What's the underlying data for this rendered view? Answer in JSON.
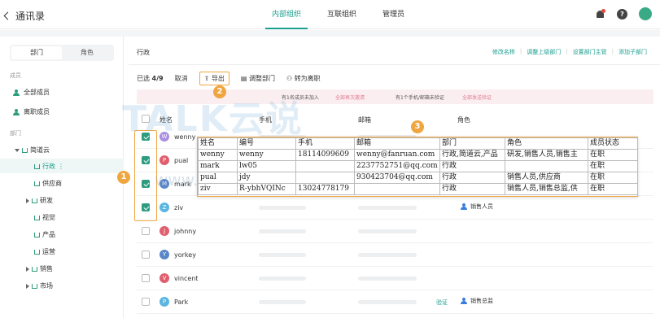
{
  "header": {
    "back_label": "通讯录",
    "tabs": [
      {
        "label": "内部组织",
        "active": true
      },
      {
        "label": "互联组织",
        "active": false
      },
      {
        "label": "管理员",
        "active": false
      }
    ]
  },
  "sidebar": {
    "segment": {
      "dept": "部门",
      "role": "角色"
    },
    "members_heading": "成员",
    "all_members": "全部成员",
    "left_members": "离职成员",
    "dept_heading": "部门",
    "tree": {
      "root": "简道云",
      "items": [
        "行政",
        "供应商",
        "研发",
        "视觉",
        "产品",
        "运营",
        "销售",
        "市场"
      ]
    }
  },
  "main": {
    "dept_title": "行政",
    "links": [
      "修改名称",
      "调整上级部门",
      "设置部门主管",
      "添加子部门"
    ],
    "toolbar": {
      "selected_prefix": "已选",
      "selected_count": "4/9",
      "cancel": "取消",
      "export": "导出",
      "adjust_dept": "调整部门",
      "to_leave": "转为离职"
    },
    "notice": {
      "text1": "有1名成员未加入",
      "link1": "全部再次邀请",
      "text2": "有1个手机/邮箱未验证",
      "link2": "全部发送验证"
    },
    "columns": {
      "name": "姓名",
      "phone": "手机",
      "email": "邮箱",
      "role": "角色"
    },
    "rows": [
      {
        "name": "wenny",
        "initial": "W",
        "color": "#a98de0",
        "checked": true,
        "role": ""
      },
      {
        "name": "pual",
        "initial": "P",
        "color": "#e05f6f",
        "checked": true,
        "role": ""
      },
      {
        "name": "mark",
        "initial": "M",
        "color": "#5a86c8",
        "checked": true,
        "role": ""
      },
      {
        "name": "ziv",
        "initial": "Z",
        "color": "#5bb5e0",
        "checked": true,
        "role": "销售人员"
      },
      {
        "name": "johnny",
        "initial": "J",
        "color": "#e05f6f",
        "checked": false,
        "role": ""
      },
      {
        "name": "yorkey",
        "initial": "Y",
        "color": "#5a86c8",
        "checked": false,
        "role": ""
      },
      {
        "name": "vincent",
        "initial": "V",
        "color": "#e05f6f",
        "checked": false,
        "role": ""
      },
      {
        "name": "Park",
        "initial": "P",
        "color": "#5bb5e0",
        "checked": false,
        "role": "销售总监",
        "verify": "验证"
      }
    ]
  },
  "badges": [
    "1",
    "2",
    "3"
  ],
  "popup": {
    "headers": [
      "姓名",
      "编号",
      "手机",
      "邮箱",
      "部门",
      "角色",
      "成员状态"
    ],
    "rows": [
      [
        "wenny",
        "wenny",
        "18114099609",
        "wenny@fanruan.com",
        "行政,简道云,产品",
        "研发,销售人员,销售主",
        "在职"
      ],
      [
        "mark",
        "lw05",
        "",
        "2237752751@qq.com",
        "行政",
        "",
        "在职"
      ],
      [
        "pual",
        "jdy",
        "",
        "930423704@qq.com",
        "行政",
        "销售人员,供应商",
        "在职"
      ],
      [
        "ziv",
        "R-ybhVQINc",
        "13024778179",
        "",
        "行政",
        "销售人员,销售总监,供",
        "在职"
      ]
    ]
  },
  "watermark": {
    "brand": "TALK云说",
    "url": "www.idctalk.com-国内专业云计算交流服务平台"
  }
}
